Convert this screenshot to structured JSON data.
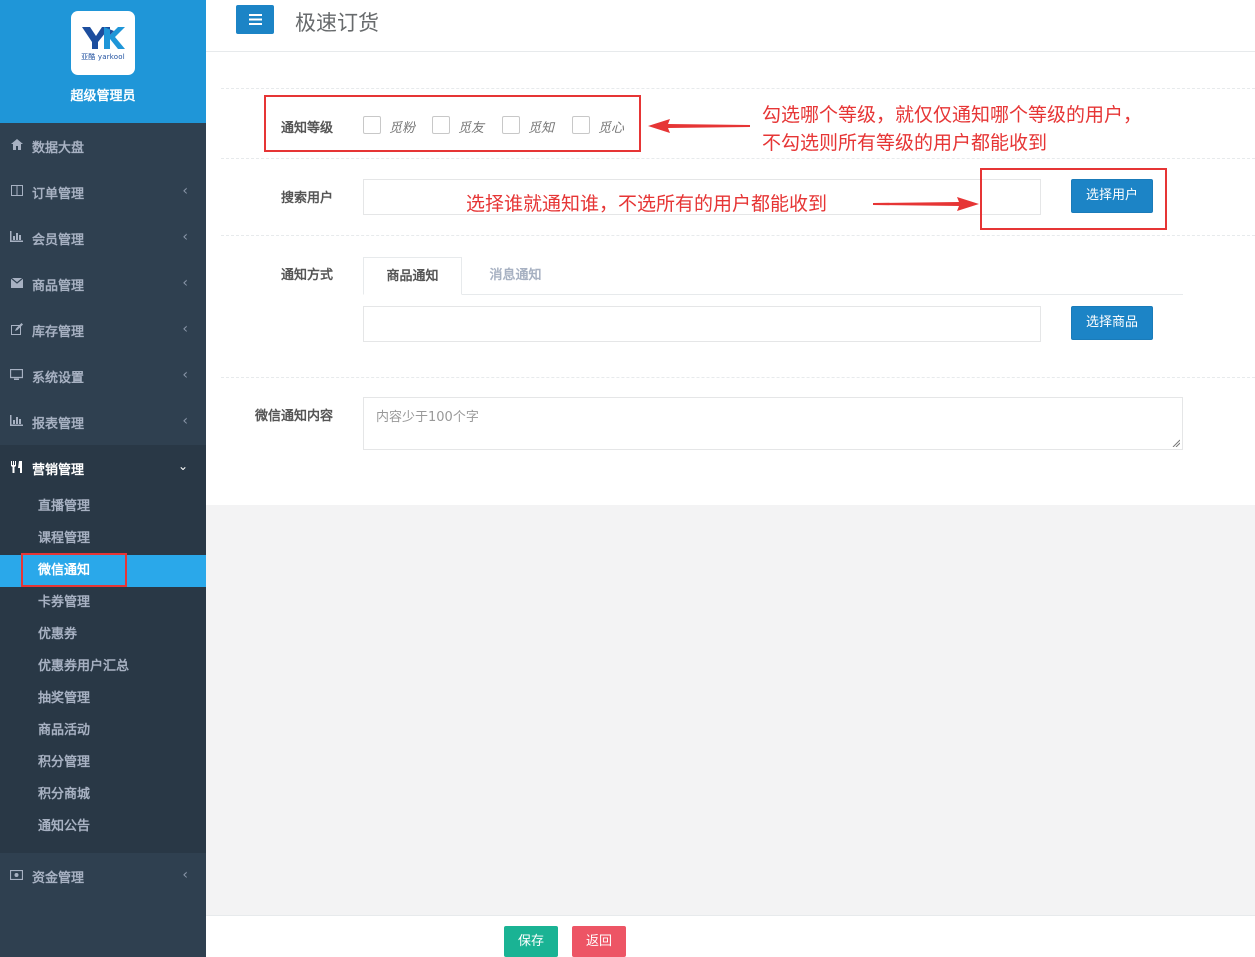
{
  "brand": {
    "logo_text": "亚酷 yarkool",
    "name": "超级管理员",
    "logo_colors": [
      "#1d4e9e",
      "#1f96d8"
    ]
  },
  "sidebar": {
    "items": [
      {
        "label": "数据大盘",
        "icon": "home-icon"
      },
      {
        "label": "订单管理",
        "icon": "columns-icon"
      },
      {
        "label": "会员管理",
        "icon": "bar-chart-icon"
      },
      {
        "label": "商品管理",
        "icon": "envelope-icon"
      },
      {
        "label": "库存管理",
        "icon": "edit-icon"
      },
      {
        "label": "系统设置",
        "icon": "desktop-icon"
      },
      {
        "label": "报表管理",
        "icon": "bar-chart-icon"
      },
      {
        "label": "营销管理",
        "icon": "cutlery-icon"
      },
      {
        "label": "资金管理",
        "icon": "money-icon"
      }
    ],
    "submenu": [
      "直播管理",
      "课程管理",
      "微信通知",
      "卡券管理",
      "优惠券",
      "优惠券用户汇总",
      "抽奖管理",
      "商品活动",
      "积分管理",
      "积分商城",
      "通知公告"
    ],
    "active_sub": "微信通知"
  },
  "header": {
    "menu_icon": "hamburger-icon",
    "title": "极速订货"
  },
  "form": {
    "level_label": "通知等级",
    "levels": [
      "觅粉",
      "觅友",
      "觅知",
      "觅心"
    ],
    "search_label": "搜索用户",
    "search_value": "",
    "select_user_btn": "选择用户",
    "method_label": "通知方式",
    "tabs": [
      "商品通知",
      "消息通知"
    ],
    "active_tab": "商品通知",
    "goods_value": "",
    "select_goods_btn": "选择商品",
    "content_label": "微信通知内容",
    "content_placeholder": "内容少于100个字"
  },
  "annotations": {
    "level_note_line1": "勾选哪个等级，就仅仅通知哪个等级的用户，",
    "level_note_line2": "不勾选则所有等级的用户都能收到",
    "user_note": "选择谁就通知谁，不选所有的用户都能收到",
    "color": "#e63535"
  },
  "footer": {
    "save": "保存",
    "back": "返回"
  }
}
